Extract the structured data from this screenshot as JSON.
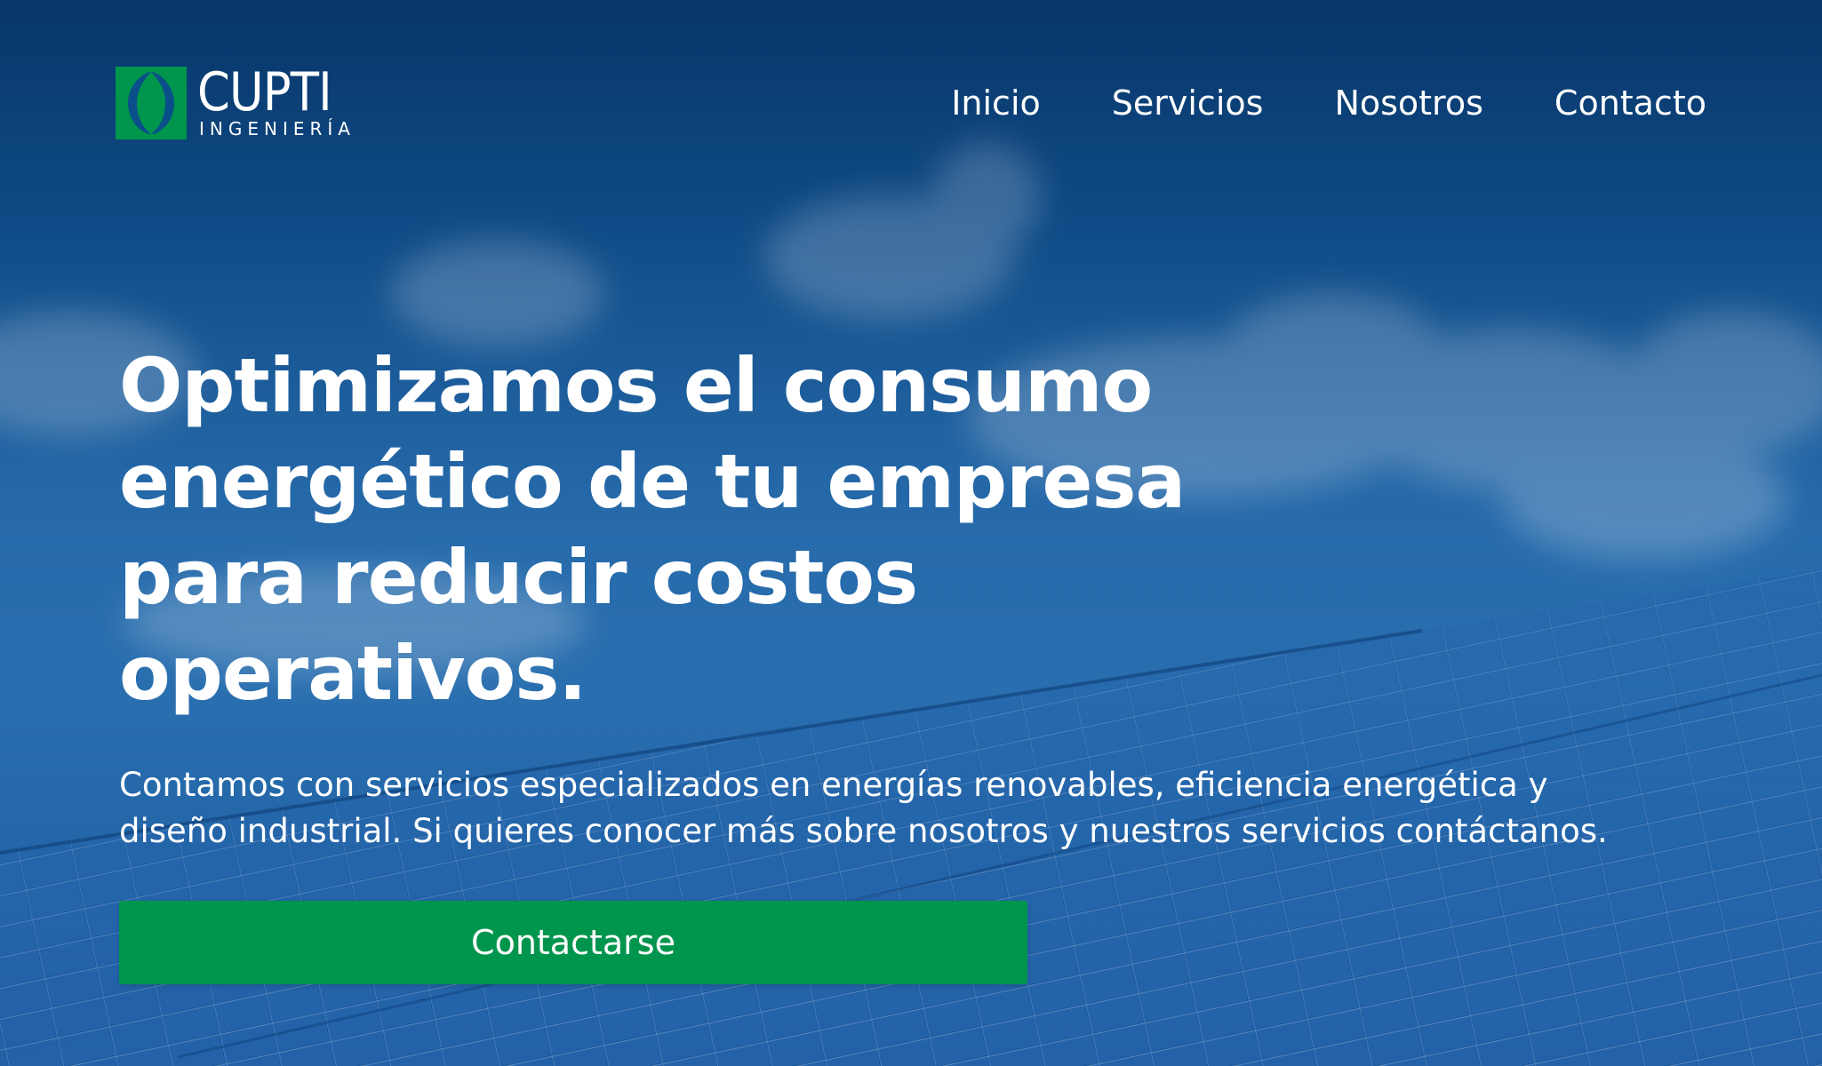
{
  "brand": {
    "name": "CUPTI",
    "subtitle": "INGENIERÍA",
    "logo_icon": "leaf-icon",
    "colors": {
      "green": "#00954d",
      "sky": "#12538f"
    }
  },
  "nav": {
    "items": [
      {
        "label": "Inicio"
      },
      {
        "label": "Servicios"
      },
      {
        "label": "Nosotros"
      },
      {
        "label": "Contacto"
      }
    ]
  },
  "hero": {
    "headline": "Optimizamos el consumo energético de tu empresa para reducir costos operativos.",
    "description": "Contamos con servicios especializados en energías renovables, eficiencia energética y diseño industrial.  Si quieres conocer más sobre nosotros y nuestros servicios contáctanos.",
    "cta_label": "Contactarse",
    "background_image": "solar-panels-sky"
  }
}
